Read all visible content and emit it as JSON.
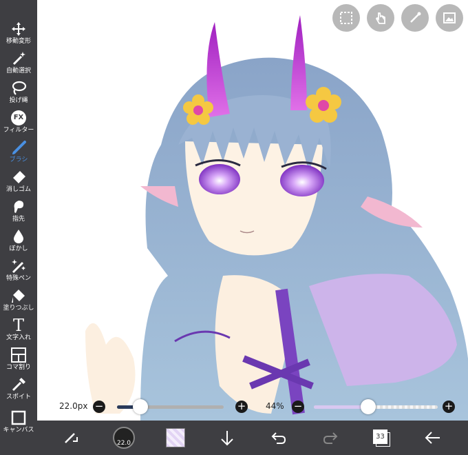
{
  "sidebar": {
    "tools": [
      {
        "label": "移動変形",
        "icon": "move-icon"
      },
      {
        "label": "自動選択",
        "icon": "magic-wand-icon"
      },
      {
        "label": "投げ縄",
        "icon": "lasso-icon"
      },
      {
        "label": "フィルター",
        "icon": "filter-fx-icon",
        "badge": "FX"
      },
      {
        "label": "ブラシ",
        "icon": "brush-icon",
        "active": true
      },
      {
        "label": "消しゴム",
        "icon": "eraser-icon"
      },
      {
        "label": "指先",
        "icon": "finger-smudge-icon"
      },
      {
        "label": "ぼかし",
        "icon": "blur-drop-icon"
      },
      {
        "label": "特殊ペン",
        "icon": "special-pen-icon"
      },
      {
        "label": "塗りつぶし",
        "icon": "fill-bucket-icon"
      },
      {
        "label": "文字入れ",
        "icon": "text-icon",
        "glyph": "T"
      },
      {
        "label": "コマ割り",
        "icon": "frame-divider-icon"
      },
      {
        "label": "スポイト",
        "icon": "eyedropper-icon"
      },
      {
        "label": "キャンバス",
        "icon": "canvas-icon"
      }
    ]
  },
  "top_buttons": [
    "selection-icon",
    "gesture-hand-icon",
    "ruler-icon",
    "material-image-icon"
  ],
  "brush_size": {
    "label": "22.0px",
    "value_fraction": 0.22
  },
  "opacity": {
    "label": "44%",
    "value_fraction": 0.44
  },
  "bottom_toolbar": {
    "brush_badge": "22.0",
    "layer_count": "33",
    "icons": [
      "transform-switch-icon",
      "brush-size-icon",
      "color-swatch-icon",
      "download-icon",
      "undo-icon",
      "redo-icon",
      "layers-icon",
      "back-arrow-icon"
    ]
  },
  "colors": {
    "sidebar_bg": "#3e3e42",
    "active_tool": "#4a90e2",
    "hair": "#8fa8c8",
    "eyes": "#b060e0",
    "horns": "#c040d0",
    "flower": "#f5c842",
    "dress": "#c8b0e8"
  }
}
